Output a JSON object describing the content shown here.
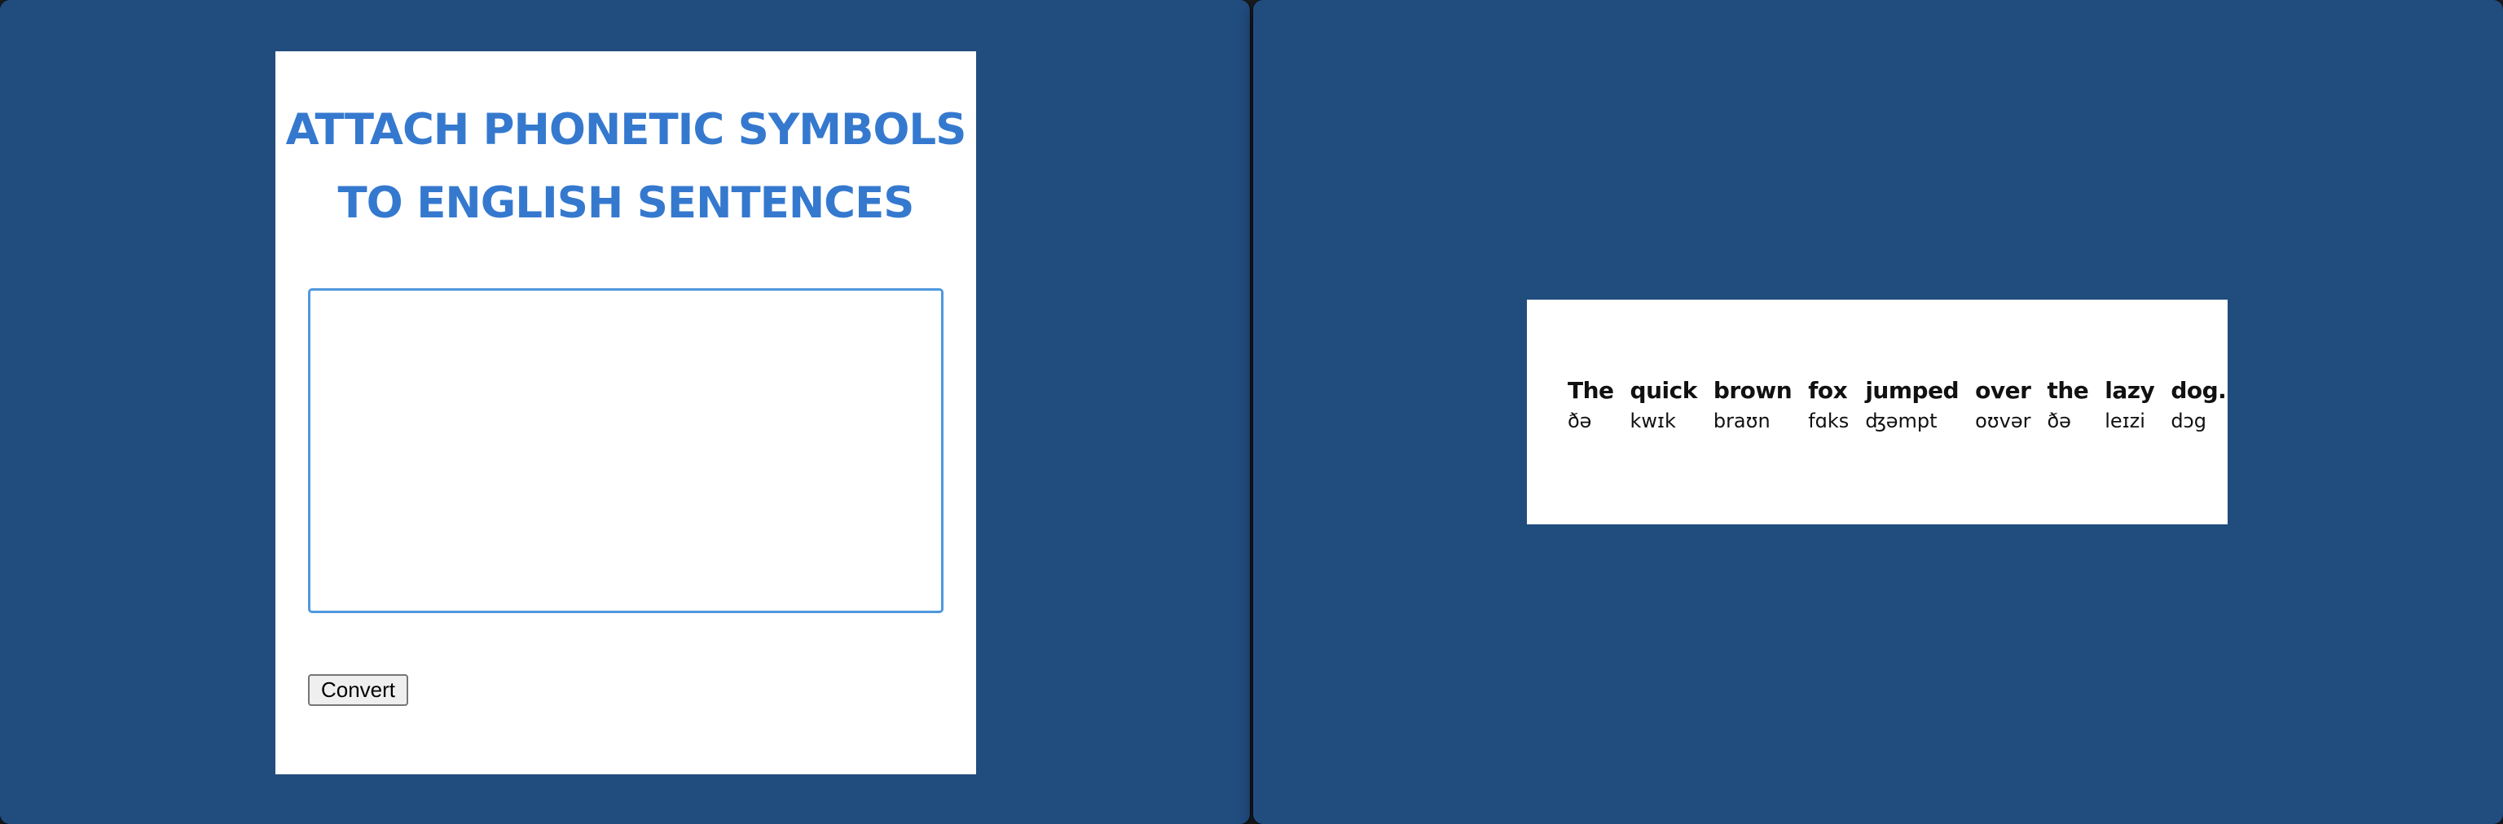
{
  "left_panel": {
    "title_line1": "ATTACH PHONETIC SYMBOLS",
    "title_line2": "TO ENGLISH SENTENCES",
    "input_value": "",
    "convert_label": "Convert"
  },
  "right_panel": {
    "words": [
      {
        "word": "The",
        "ipa": "ðə"
      },
      {
        "word": "quick",
        "ipa": "kwɪk"
      },
      {
        "word": "brown",
        "ipa": "braʊn"
      },
      {
        "word": "fox",
        "ipa": "fɑks"
      },
      {
        "word": "jumped",
        "ipa": "ʤəmpt"
      },
      {
        "word": "over",
        "ipa": "oʊvər"
      },
      {
        "word": "the",
        "ipa": "ðə"
      },
      {
        "word": "lazy",
        "ipa": "leɪzi"
      },
      {
        "word": "dog.",
        "ipa": "dɔg"
      }
    ]
  },
  "colors": {
    "background": "#214c7e",
    "title": "#3579cf",
    "input_border": "#4f98de"
  }
}
